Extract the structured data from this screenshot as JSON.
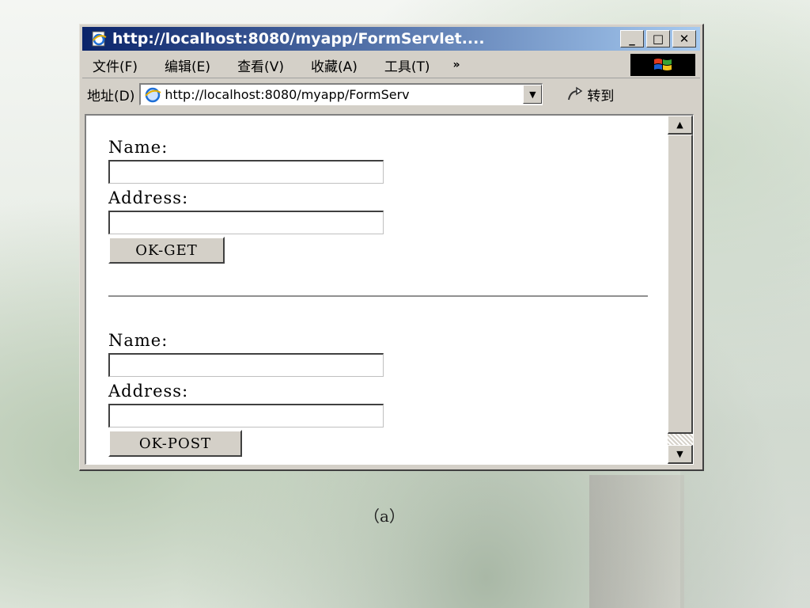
{
  "window": {
    "title": "http://localhost:8080/myapp/FormServlet....",
    "minimize_label": "_",
    "maximize_label": "□",
    "close_label": "✕"
  },
  "menubar": {
    "items": [
      "文件(F)",
      "编辑(E)",
      "查看(V)",
      "收藏(A)",
      "工具(T)"
    ],
    "chevron": "»"
  },
  "addressbar": {
    "label": "地址(D)",
    "url": "http://localhost:8080/myapp/FormServ",
    "go_label": "转到"
  },
  "form_get": {
    "name_label": "Name:",
    "name_value": "",
    "address_label": "Address:",
    "address_value": "",
    "submit_label": "OK-GET"
  },
  "form_post": {
    "name_label": "Name:",
    "name_value": "",
    "address_label": "Address:",
    "address_value": "",
    "submit_label": "OK-POST"
  },
  "caption": "（a）",
  "icons": {
    "title": "ie-page-icon",
    "address": "ie-globe-icon",
    "go": "go-arrow-icon",
    "logo": "windows-logo-icon"
  }
}
